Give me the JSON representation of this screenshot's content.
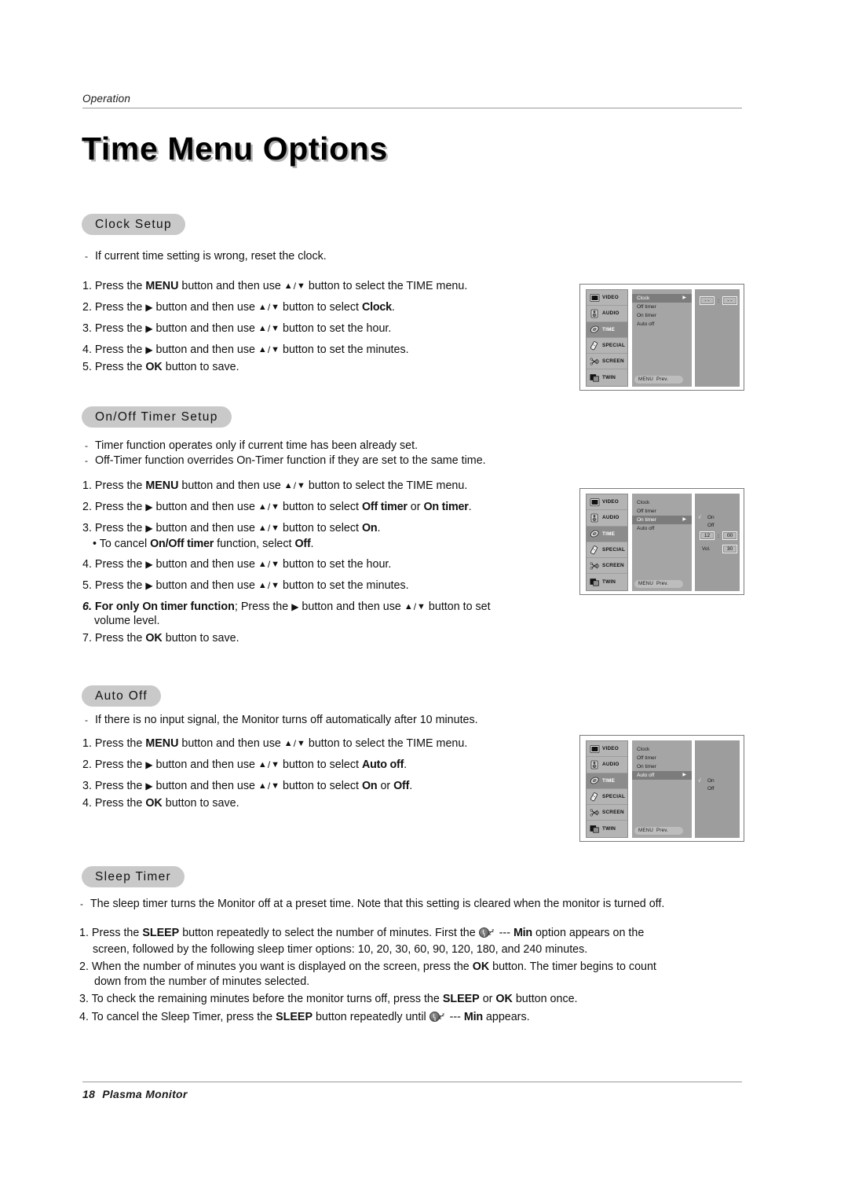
{
  "header": {
    "breadcrumb": "Operation",
    "title": "Time Menu Options"
  },
  "footer": {
    "page_number": "18",
    "product": "Plasma Monitor"
  },
  "sections": {
    "clock_setup": {
      "pill": "Clock Setup",
      "note": "If current time setting is wrong, reset the clock.",
      "steps": {
        "s1_a": "1.",
        "s1_b": "Press the",
        "s1_menu": "MENU",
        "s1_c": "button and then use",
        "s1_d": "button to select the TIME menu.",
        "s2_a": "2.",
        "s2_b": "Press the",
        "s2_c": "button and then use",
        "s2_d": "button to select",
        "s2_clock": "Clock",
        "s3_a": "3.",
        "s3_b": "Press the",
        "s3_c": "button and then use",
        "s3_d": "button to set the hour.",
        "s4_a": "4.",
        "s4_b": "Press the",
        "s4_c": "button and then use",
        "s4_d": "button to set the minutes.",
        "s5_a": "5.",
        "s5_b": "Press the",
        "s5_ok": "OK",
        "s5_c": "button to save."
      }
    },
    "onoff_timer_setup": {
      "pill": "On/Off Timer Setup",
      "note1": "Timer function operates only if current time has been already set.",
      "note2": "Off-Timer function overrides On-Timer function if they are set to the same time.",
      "steps": {
        "s1_a": "1.",
        "s1_b": "Press the",
        "s1_menu": "MENU",
        "s1_c": "button and then use",
        "s1_d": "button to select the TIME menu.",
        "s2_a": "2.",
        "s2_b": "Press the",
        "s2_c": "button and then use",
        "s2_d": "button to select",
        "s2_off": "Off timer",
        "s2_or": "or",
        "s2_on": "On timer",
        "s3_a": "3.",
        "s3_b": "Press the",
        "s3_c": "button and then use",
        "s3_d": "button to select",
        "s3_on": "On",
        "s3_bullet_a": "• To cancel",
        "s3_bullet_onoff": "On/Off timer",
        "s3_bullet_b": "function, select",
        "s3_bullet_off": "Off",
        "s4_a": "4.",
        "s4_b": "Press the",
        "s4_c": "button and then use",
        "s4_d": "button to set the hour.",
        "s5_a": "5.",
        "s5_b": "Press the",
        "s5_c": "button and then use",
        "s5_d": "button to set the minutes.",
        "s6_a": "6.",
        "s6_b": "For only",
        "s6_ontimer": "On timer",
        "s6_c": "function",
        "s6_d": "; Press the",
        "s6_e": "button and then use",
        "s6_f": "button to set",
        "s6_g": "volume level.",
        "s7_a": "7.",
        "s7_b": "Press the",
        "s7_ok": "OK",
        "s7_c": "button to save."
      }
    },
    "auto_off": {
      "pill": "Auto Off",
      "note": "If there is no input signal, the Monitor turns off automatically after 10 minutes.",
      "steps": {
        "s1_a": "1.",
        "s1_b": "Press the",
        "s1_menu": "MENU",
        "s1_c": "button and then use",
        "s1_d": "button to select the TIME menu.",
        "s2_a": "2.",
        "s2_b": "Press the",
        "s2_c": "button and then use",
        "s2_d": "button to select",
        "s2_autooff": "Auto off",
        "s3_a": "3.",
        "s3_b": "Press the",
        "s3_c": "button and then use",
        "s3_d": "button to select",
        "s3_on": "On",
        "s3_or": "or",
        "s3_off": "Off",
        "s4_a": "4.",
        "s4_b": "Press the",
        "s4_ok": "OK",
        "s4_c": "button to save."
      }
    },
    "sleep_timer": {
      "pill": "Sleep Timer",
      "note": "The sleep timer turns the Monitor off at a preset time. Note that this setting is cleared when the monitor is turned off.",
      "steps": {
        "s1_a": "1.",
        "s1_b": "Press the",
        "s1_sleep": "SLEEP",
        "s1_c": "button repeatedly to select the number of minutes. First the",
        "s1_dashes": "---",
        "s1_min": "Min",
        "s1_d": "option appears on the",
        "s1_line2": "screen, followed by the following sleep timer options: 10, 20, 30, 60, 90, 120, 180, and 240 minutes.",
        "s2_a": "2.",
        "s2_b": "When the number of minutes you want is displayed on the screen, press the",
        "s2_ok": "OK",
        "s2_c": "button. The timer begins to count",
        "s2_line2": "down from the number of minutes selected.",
        "s3_a": "3.",
        "s3_b": "To check the remaining minutes before the monitor turns off, press the",
        "s3_sleep": "SLEEP",
        "s3_or": "or",
        "s3_ok": "OK",
        "s3_c": "button once.",
        "s4_a": "4.",
        "s4_b": "To cancel the Sleep Timer, press the",
        "s4_sleep": "SLEEP",
        "s4_c": "button repeatedly until",
        "s4_dashes": "---",
        "s4_min": "Min",
        "s4_d": "appears."
      }
    }
  },
  "osd_menus": [
    {
      "id": "clock",
      "sidebar": [
        "VIDEO",
        "AUDIO",
        "TIME",
        "SPECIAL",
        "SCREEN",
        "TWIN"
      ],
      "sidebar_selected": "TIME",
      "items": [
        "Clock",
        "Off timer",
        "On timer",
        "Auto off"
      ],
      "selected_item": "Clock",
      "bottom_menu": "MENU",
      "bottom_prev": "Prev.",
      "detail": {
        "hour": "- -",
        "colon": ":",
        "minute": "- -"
      }
    },
    {
      "id": "on-timer",
      "sidebar": [
        "VIDEO",
        "AUDIO",
        "TIME",
        "SPECIAL",
        "SCREEN",
        "TWIN"
      ],
      "sidebar_selected": "TIME",
      "items": [
        "Clock",
        "Off timer",
        "On timer",
        "Auto off"
      ],
      "selected_item": "On timer",
      "bottom_menu": "MENU",
      "bottom_prev": "Prev.",
      "detail": {
        "check": "√",
        "on": "On",
        "off": "Off",
        "hour": "12",
        "colon": ":",
        "minute": "00",
        "vol_label": "Vol.",
        "vol_value": "30"
      }
    },
    {
      "id": "auto-off",
      "sidebar": [
        "VIDEO",
        "AUDIO",
        "TIME",
        "SPECIAL",
        "SCREEN",
        "TWIN"
      ],
      "sidebar_selected": "TIME",
      "items": [
        "Clock",
        "Off timer",
        "On timer",
        "Auto off"
      ],
      "selected_item": "Auto off",
      "bottom_menu": "MENU",
      "bottom_prev": "Prev.",
      "detail": {
        "check": "√",
        "on": "On",
        "off": "Off"
      }
    }
  ],
  "colors": {
    "pill_bg": "#c9c9c9",
    "osd_sidebar": "#b4b4b4",
    "osd_mid": "#a5a5a5",
    "osd_right": "#9d9d9d",
    "osd_selected": "#7c7c7c"
  }
}
